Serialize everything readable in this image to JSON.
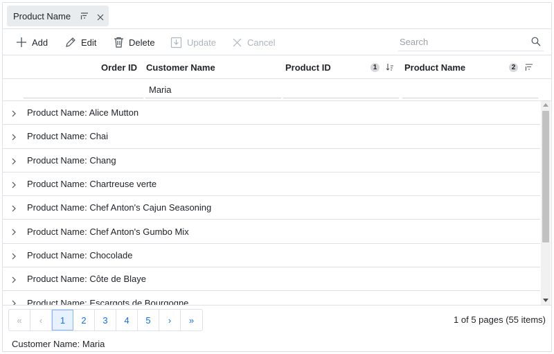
{
  "group_bar": {
    "chip_label": "Product Name"
  },
  "toolbar": {
    "add": "Add",
    "edit": "Edit",
    "delete": "Delete",
    "update": "Update",
    "cancel": "Cancel",
    "search_placeholder": "Search"
  },
  "columns": {
    "order_id": "Order ID",
    "customer_name": "Customer Name",
    "product_id": "Product ID",
    "product_id_sort_index": "1",
    "product_name": "Product Name",
    "product_name_sort_index": "2"
  },
  "filters": {
    "order_id": "",
    "customer_name": "Maria",
    "product_id": "",
    "product_name": ""
  },
  "groups": [
    "Product Name: Alice Mutton",
    "Product Name: Chai",
    "Product Name: Chang",
    "Product Name: Chartreuse verte",
    "Product Name: Chef Anton's Cajun Seasoning",
    "Product Name: Chef Anton's Gumbo Mix",
    "Product Name: Chocolade",
    "Product Name: Côte de Blaye",
    "Product Name: Escargots de Bourgogne"
  ],
  "pager": {
    "first": "«",
    "prev": "‹",
    "pages": [
      "1",
      "2",
      "3",
      "4",
      "5"
    ],
    "current_page": 1,
    "next": "›",
    "last": "»",
    "info": "1 of 5 pages (55 items)",
    "footer": "Customer Name: Maria"
  },
  "colors": {
    "accent": "#0d6efd",
    "border": "#dee2e6",
    "disabled": "#adb5bd"
  }
}
